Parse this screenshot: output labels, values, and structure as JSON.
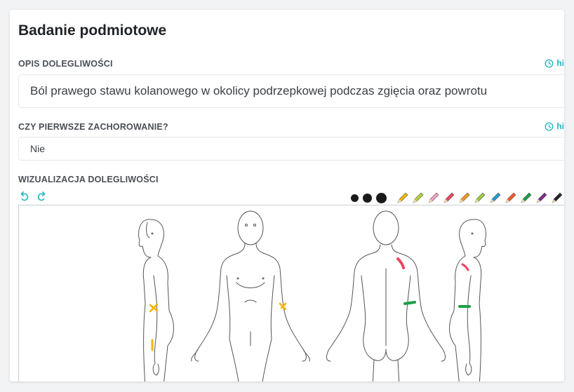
{
  "section": {
    "title": "Badanie podmiotowe"
  },
  "complaint": {
    "label": "OPIS DOLEGLIWOŚCI",
    "history_label": "hi",
    "value": "Ból prawego stawu kolanowego w okolicy podrzepkowej podczas zgięcia oraz powrotu"
  },
  "first_illness": {
    "label": "CZY PIERWSZE ZACHOROWANIE?",
    "history_label": "hi",
    "value": "Nie"
  },
  "visualization": {
    "label": "WIZUALIZACJA DOLEGLIWOŚCI",
    "toolbar": {
      "undo_icon": "undo-icon",
      "redo_icon": "redo-icon"
    },
    "brush_sizes": [
      "small",
      "medium",
      "large"
    ],
    "pen_colors": [
      "#f5b400",
      "#b5d334",
      "#f7a1c4",
      "#e8475f",
      "#f39a1e",
      "#9ccc3a",
      "#1f9bd1",
      "#ef5a2a",
      "#1d9e4a",
      "#7a2d86",
      "#222222"
    ],
    "figures": [
      "side-left",
      "front",
      "back",
      "side-right"
    ]
  }
}
